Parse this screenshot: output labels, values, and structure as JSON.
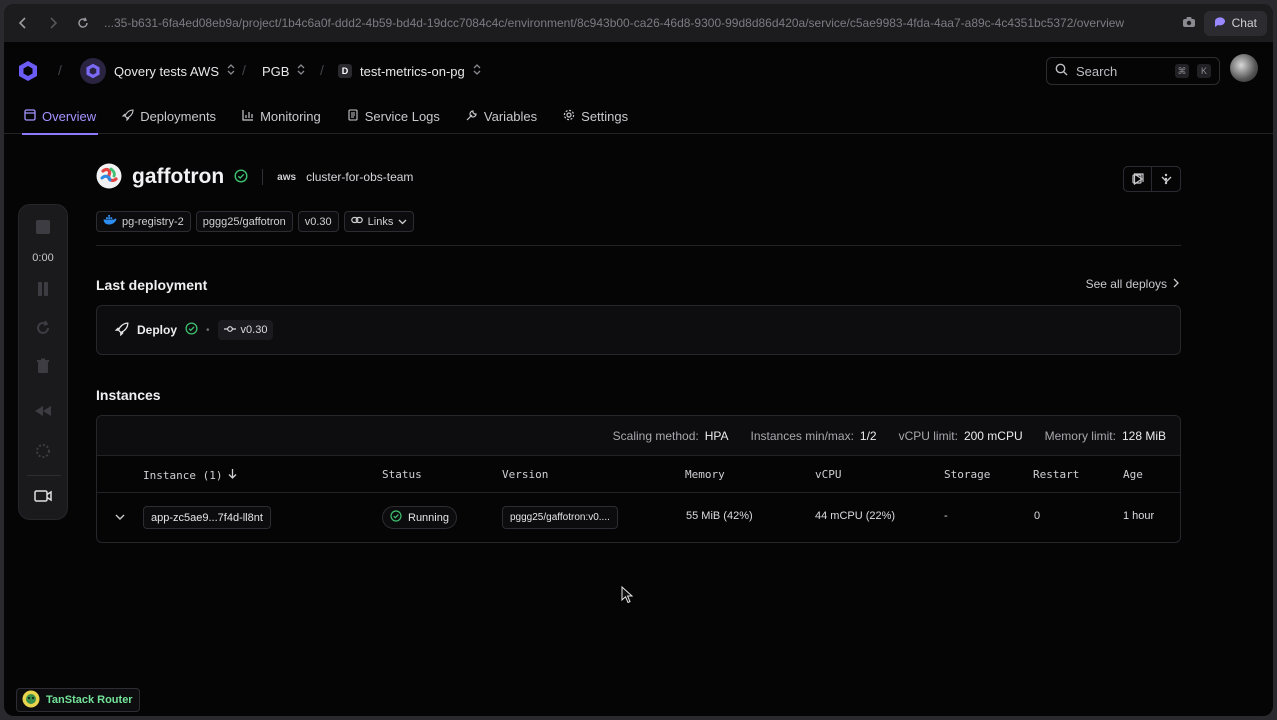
{
  "browser": {
    "url": "...35-b631-6fa4ed08eb9a/project/1b4c6a0f-ddd2-4b59-bd4d-19dcc7084c4c/environment/8c943b00-ca26-46d8-9300-99d8d86d420a/service/c5ae9983-4fda-4aa7-a89c-4c4351bc5372/overview",
    "chat_label": "Chat"
  },
  "header": {
    "organization": "Qovery tests AWS",
    "project": "PGB",
    "environment_badge": "D",
    "environment": "test-metrics-on-pg",
    "search_label": "Search",
    "search_keys": [
      "⌘",
      "K"
    ]
  },
  "tabs": [
    {
      "label": "Overview",
      "icon": "layout-icon",
      "active": true
    },
    {
      "label": "Deployments",
      "icon": "rocket-icon",
      "active": false
    },
    {
      "label": "Monitoring",
      "icon": "chart-icon",
      "active": false
    },
    {
      "label": "Service Logs",
      "icon": "logs-icon",
      "active": false
    },
    {
      "label": "Variables",
      "icon": "wrench-icon",
      "active": false
    },
    {
      "label": "Settings",
      "icon": "gear-icon",
      "active": false
    }
  ],
  "recorder": {
    "time": "0:00"
  },
  "service": {
    "name": "gaffotron",
    "cloud": "aws",
    "cluster": "cluster-for-obs-team",
    "badges": {
      "registry": "pg-registry-2",
      "image": "pggg25/gaffotron",
      "tag": "v0.30",
      "links": "Links"
    }
  },
  "last_deployment": {
    "title": "Last deployment",
    "see_all": "See all deploys",
    "label": "Deploy",
    "separator": "•",
    "version": "v0.30"
  },
  "instances": {
    "title": "Instances",
    "meta": [
      {
        "key": "Scaling method:",
        "value": "HPA"
      },
      {
        "key": "Instances min/max:",
        "value": "1/2"
      },
      {
        "key": "vCPU limit:",
        "value": "200 mCPU"
      },
      {
        "key": "Memory limit:",
        "value": "128 MiB"
      }
    ],
    "columns": [
      "Instance (1)",
      "Status",
      "Version",
      "Memory",
      "vCPU",
      "Storage",
      "Restart",
      "Age"
    ],
    "rows": [
      {
        "instance": "app-zc5ae9...7f4d-ll8nt",
        "status": "Running",
        "version": "pggg25/gaffotron:v0....",
        "memory": "55 MiB (42%)",
        "vcpu": "44 mCPU (22%)",
        "storage": "-",
        "restart": "0",
        "age": "1 hour"
      }
    ]
  },
  "devtools": {
    "label": "TanStack Router"
  },
  "colors": {
    "accent": "#8b7bff",
    "success": "#3ec26f",
    "background": "#050506"
  }
}
